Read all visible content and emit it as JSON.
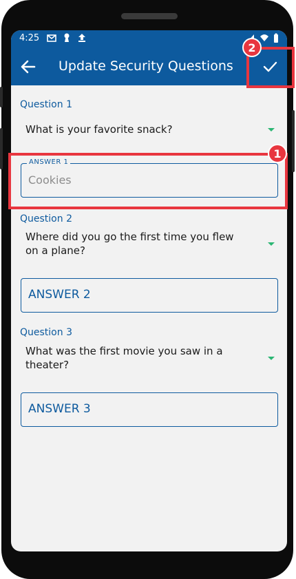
{
  "status_bar": {
    "time": "4:25"
  },
  "app_bar": {
    "title": "Update Security Questions"
  },
  "questions": [
    {
      "label": "Question 1",
      "selected": "What is your favorite snack?",
      "answer_label": "ANSWER 1",
      "answer_value": "Cookies"
    },
    {
      "label": "Question 2",
      "selected": "Where did you go the first time you flew on a plane?",
      "answer_placeholder": "ANSWER 2"
    },
    {
      "label": "Question 3",
      "selected": "What was the first movie you saw in a theater?",
      "answer_placeholder": "ANSWER 3"
    }
  ],
  "annotations": {
    "badge1": "1",
    "badge2": "2"
  },
  "colors": {
    "primary": "#0d5a9e",
    "accent_arrow": "#2bb673",
    "highlight": "#e8363f",
    "background": "#f2f2f2"
  }
}
